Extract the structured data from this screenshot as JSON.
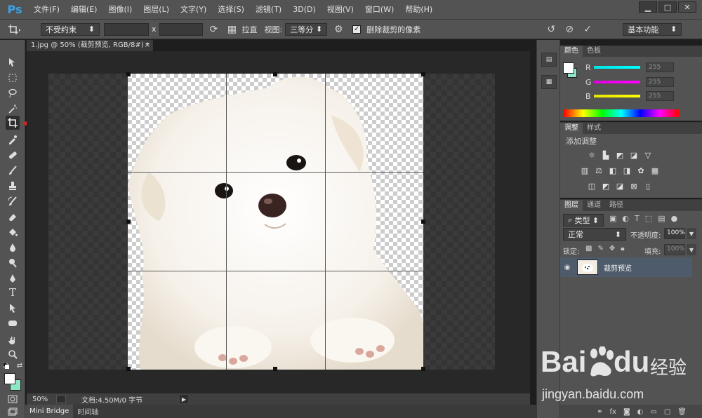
{
  "app": {
    "logo": "Ps",
    "menu": [
      "文件(F)",
      "编辑(E)",
      "图像(I)",
      "图层(L)",
      "文字(Y)",
      "选择(S)",
      "滤镜(T)",
      "3D(D)",
      "视图(V)",
      "窗口(W)",
      "帮助(H)"
    ],
    "window_buttons": [
      "▁",
      "□",
      "✕"
    ]
  },
  "options": {
    "ratio_select": "不受约束",
    "x_label": "x",
    "straighten_label": "拉直",
    "view_label": "视图:",
    "view_select": "三等分",
    "delete_pixels_label": "删除裁剪的像素",
    "delete_pixels_checked": true,
    "workspace_select": "基本功能"
  },
  "document": {
    "tab_title": "1.jpg @ 50% (裁剪预览, RGB/8#) *",
    "tab_close": "×",
    "zoom": "50%",
    "doc_info": "文档:4.50M/0 字节"
  },
  "bottom_tabs": [
    "Mini Bridge",
    "时间轴"
  ],
  "color_panel": {
    "tabs": [
      "颜色",
      "色板"
    ],
    "channels": [
      {
        "label": "R",
        "value": "255",
        "color": "#00e5e5"
      },
      {
        "label": "G",
        "value": "255",
        "color": "#e000e0"
      },
      {
        "label": "B",
        "value": "255",
        "color": "#e5e500"
      }
    ]
  },
  "adjust_panel": {
    "tabs": [
      "调整",
      "样式"
    ],
    "title": "添加调整"
  },
  "layers_panel": {
    "tabs": [
      "图层",
      "通道",
      "路径"
    ],
    "filter_select": "类型",
    "blend_mode": "正常",
    "opacity_label": "不透明度:",
    "opacity_value": "100%",
    "lock_label": "锁定:",
    "fill_label": "填充:",
    "fill_value": "100%",
    "layer_name": "裁剪预览"
  },
  "watermark": {
    "brand": "Bai",
    "brand_suffix": "du",
    "cn": "经验",
    "url": "jingyan.baidu.com"
  },
  "colors": {
    "accent": "#3ea2e6",
    "annotation_arrow": "#e02020",
    "selected_layer": "#4d5b6a"
  }
}
